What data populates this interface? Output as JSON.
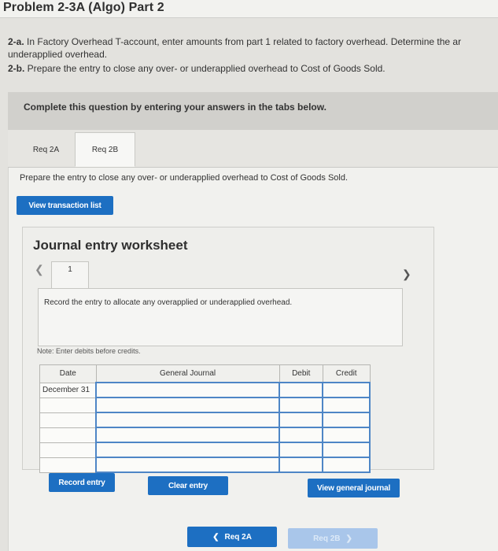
{
  "header": {
    "title": "Problem 2-3A (Algo) Part 2"
  },
  "instructions": {
    "a_prefix": "2-a.",
    "a_line1": " In Factory Overhead T-account, enter amounts from part 1 related to factory overhead. Determine the ar",
    "a_line2": "underapplied overhead.",
    "b_prefix": "2-b.",
    "b_text": " Prepare the entry to close any over- or underapplied overhead to Cost of Goods Sold."
  },
  "banner": {
    "text": "Complete this question by entering your answers in the tabs below."
  },
  "tabs": [
    {
      "label": "Req 2A",
      "active": false
    },
    {
      "label": "Req 2B",
      "active": true
    }
  ],
  "subquestion": "Prepare the entry to close any over- or underapplied overhead to Cost of Goods Sold.",
  "buttons": {
    "view_transaction_list": "View transaction list",
    "record_entry": "Record entry",
    "clear_entry": "Clear entry",
    "view_general_journal": "View general journal",
    "prev_req": "Req 2A",
    "next_req": "Req 2B"
  },
  "worksheet": {
    "title": "Journal entry worksheet",
    "entry_number": "1",
    "entry_instruction": "Record the entry to allocate any overapplied or underapplied overhead.",
    "note": "Note: Enter debits before credits.",
    "columns": {
      "date": "Date",
      "account": "General Journal",
      "debit": "Debit",
      "credit": "Credit"
    },
    "rows": [
      {
        "date": "December 31",
        "account": "",
        "debit": "",
        "credit": ""
      },
      {
        "date": "",
        "account": "",
        "debit": "",
        "credit": ""
      },
      {
        "date": "",
        "account": "",
        "debit": "",
        "credit": ""
      },
      {
        "date": "",
        "account": "",
        "debit": "",
        "credit": ""
      },
      {
        "date": "",
        "account": "",
        "debit": "",
        "credit": ""
      },
      {
        "date": "",
        "account": "",
        "debit": "",
        "credit": ""
      }
    ]
  },
  "icons": {
    "prev": "chevron-left-icon",
    "next": "chevron-right-icon"
  },
  "colors": {
    "accent": "#1d6fc2",
    "input_border": "#4e86c6"
  }
}
